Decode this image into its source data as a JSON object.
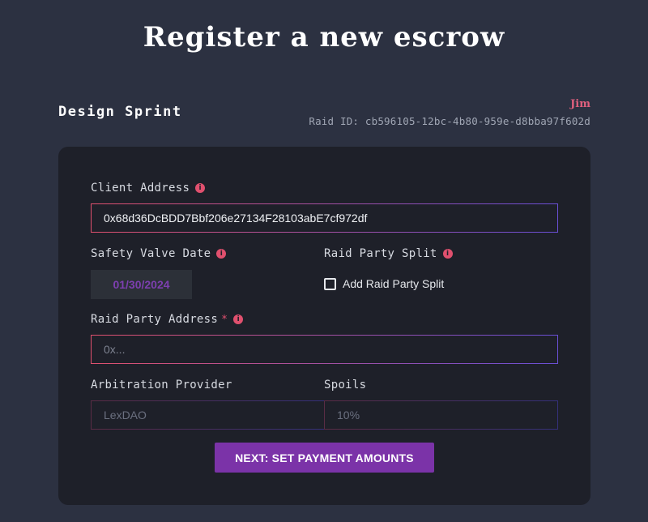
{
  "page": {
    "title": "Register a new escrow"
  },
  "raid": {
    "name": "Design Sprint",
    "member": "Jim",
    "id_text": "Raid ID: cb596105-12bc-4b80-959e-d8bba97f602d"
  },
  "form": {
    "client_address": {
      "label": "Client Address",
      "value": "0x68d36DcBDD7Bbf206e27134F28103abE7cf972df"
    },
    "safety_valve_date": {
      "label": "Safety Valve Date",
      "value": "01/30/2024"
    },
    "raid_party_split": {
      "label": "Raid Party Split",
      "checkbox_label": "Add Raid Party Split",
      "checked": false
    },
    "raid_party_address": {
      "label": "Raid Party Address",
      "required_mark": "*",
      "placeholder": "0x..."
    },
    "arbitration_provider": {
      "label": "Arbitration Provider",
      "value": "LexDAO"
    },
    "spoils": {
      "label": "Spoils",
      "value": "10%"
    },
    "next_button": "NEXT: SET PAYMENT AMOUNTS"
  },
  "icons": {
    "info": "info-icon",
    "info_glyph": "i"
  },
  "colors": {
    "background": "#2c3141",
    "card": "#1e2029",
    "accent_pink": "#e0506e",
    "accent_purple": "#7b33a8"
  }
}
